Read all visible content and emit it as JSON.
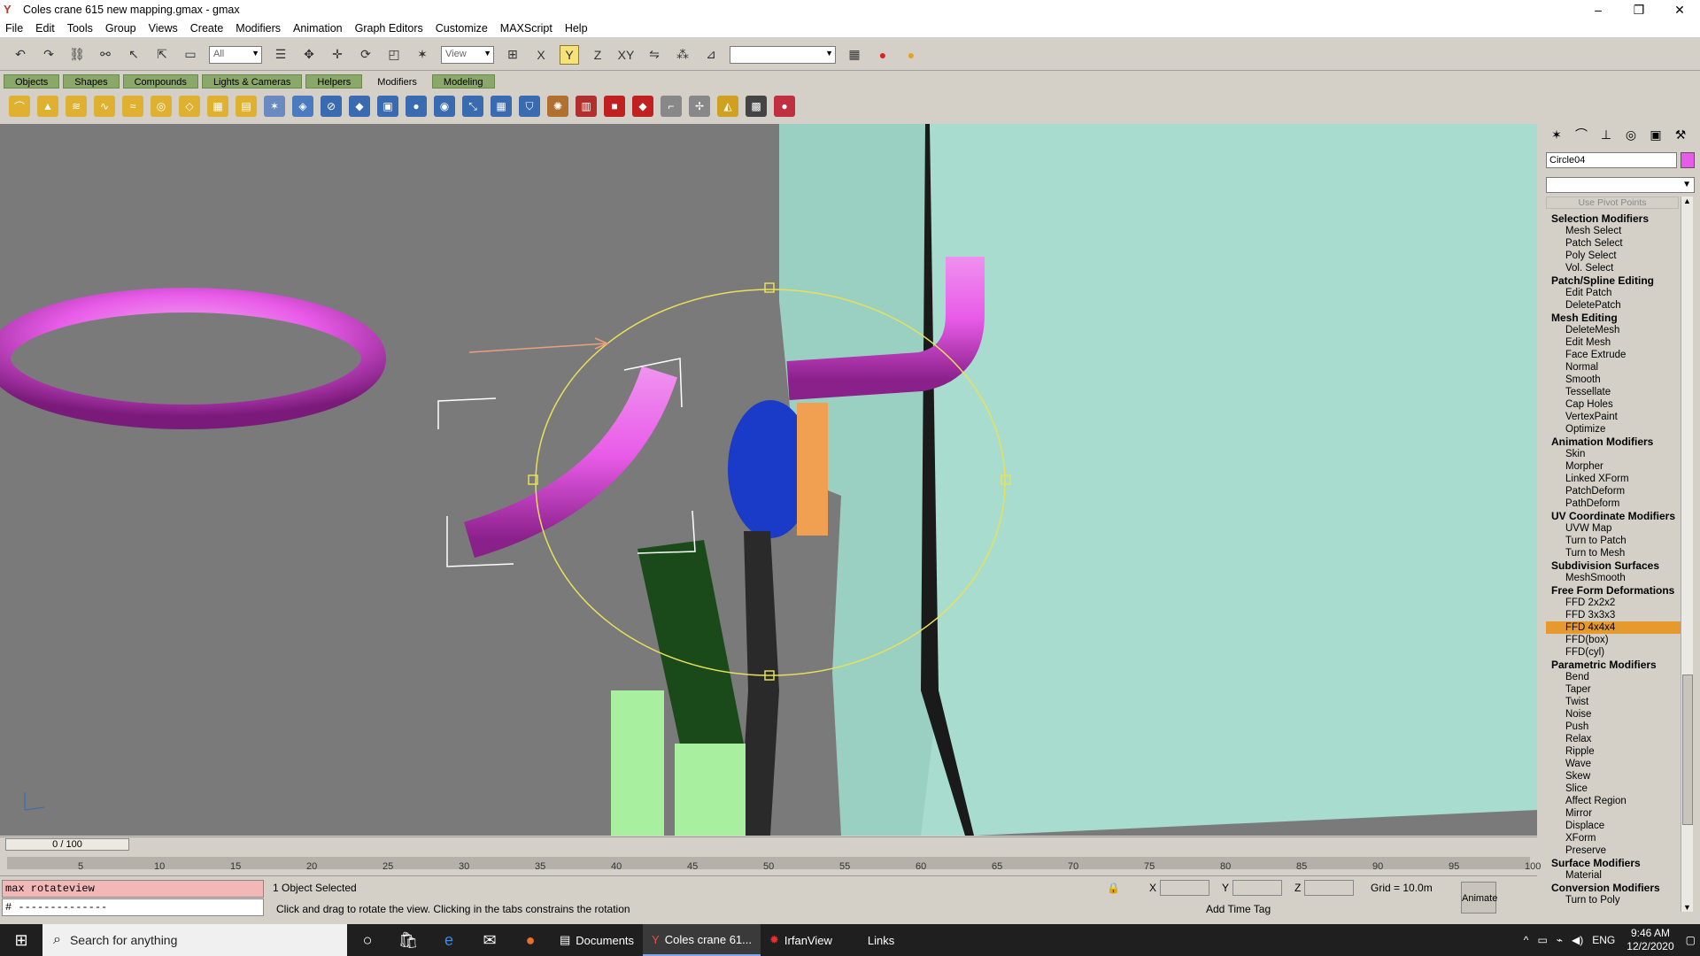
{
  "window": {
    "title": "Coles crane 615 new mapping.gmax - gmax",
    "minimize": "–",
    "restore": "❐",
    "close": "✕"
  },
  "menu": [
    "File",
    "Edit",
    "Tools",
    "Group",
    "Views",
    "Create",
    "Modifiers",
    "Animation",
    "Graph Editors",
    "Customize",
    "MAXScript",
    "Help"
  ],
  "toolbar": {
    "selection_filter": "All",
    "ref_coord": "View",
    "named_selection": ""
  },
  "tabs": [
    "Objects",
    "Shapes",
    "Compounds",
    "Lights & Cameras",
    "Helpers",
    "Modifiers",
    "Modeling"
  ],
  "selected_tab": "Modifiers",
  "command_panel": {
    "object_name": "Circle04",
    "object_color": "#e85be8",
    "use_pivot_points": "Use Pivot Points",
    "modifiers": [
      {
        "cat": "Selection Modifiers",
        "items": [
          "Mesh Select",
          "Patch Select",
          "Poly Select",
          "Vol. Select"
        ]
      },
      {
        "cat": "Patch/Spline Editing",
        "items": [
          "Edit Patch",
          "DeletePatch"
        ]
      },
      {
        "cat": "Mesh Editing",
        "items": [
          "DeleteMesh",
          "Edit Mesh",
          "Face Extrude",
          "Normal",
          "Smooth",
          "Tessellate",
          "Cap Holes",
          "VertexPaint",
          "Optimize"
        ]
      },
      {
        "cat": "Animation Modifiers",
        "items": [
          "Skin",
          "Morpher",
          "Linked XForm",
          "PatchDeform",
          "PathDeform"
        ]
      },
      {
        "cat": "UV Coordinate Modifiers",
        "items": [
          "UVW Map",
          "Turn to Patch",
          "Turn to Mesh"
        ]
      },
      {
        "cat": "Subdivision Surfaces",
        "items": [
          "MeshSmooth"
        ]
      },
      {
        "cat": "Free Form Deformations",
        "items": [
          "FFD 2x2x2",
          "FFD 3x3x3",
          "FFD 4x4x4",
          "FFD(box)",
          "FFD(cyl)"
        ]
      },
      {
        "cat": "Parametric Modifiers",
        "items": [
          "Bend",
          "Taper",
          "Twist",
          "Noise",
          "Push",
          "Relax",
          "Ripple",
          "Wave",
          "Skew",
          "Slice",
          "Affect Region",
          "Mirror",
          "Displace",
          "XForm",
          "Preserve"
        ]
      },
      {
        "cat": "Surface Modifiers",
        "items": [
          "Material"
        ]
      },
      {
        "cat": "Conversion Modifiers",
        "items": [
          "Turn to Poly"
        ]
      }
    ],
    "selected_modifier": "FFD 4x4x4"
  },
  "timeline": {
    "frame": "0 / 100",
    "ticks": [
      "5",
      "10",
      "15",
      "20",
      "25",
      "30",
      "35",
      "40",
      "45",
      "50",
      "55",
      "60",
      "65",
      "70",
      "75",
      "80",
      "85",
      "90",
      "95",
      "100"
    ]
  },
  "status": {
    "maxscript_line1": "max rotateview",
    "maxscript_line2": "# --------------",
    "selection": "1 Object Selected",
    "prompt": "Click and drag to rotate the view.  Clicking in the tabs constrains the rotation",
    "x_label": "X",
    "y_label": "Y",
    "z_label": "Z",
    "grid": "Grid = 10.0m",
    "animate": "Animate",
    "add_time_tag": "Add Time Tag"
  },
  "taskbar": {
    "search": "Search for anything",
    "tasks": [
      "Documents",
      "Coles crane 61...",
      "IrfanView"
    ],
    "links": "Links",
    "lang": "ENG",
    "time": "9:46 AM",
    "date": "12/2/2020"
  },
  "colors": {
    "torus": "#e85be8",
    "crane": "#a8dccf",
    "gizmo": "#e8e05a",
    "highlight": "#e69a2e"
  }
}
